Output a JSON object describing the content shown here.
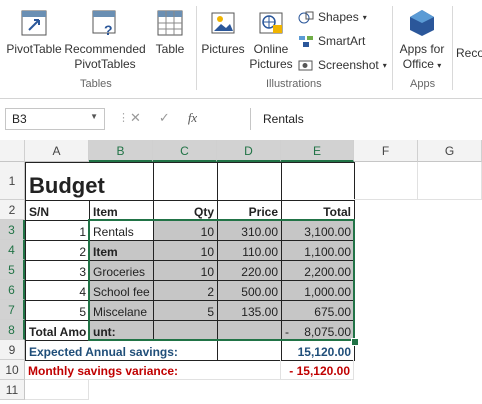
{
  "ribbon": {
    "pivottable": "PivotTable",
    "recommended_1": "Recommended",
    "recommended_2": "PivotTables",
    "table": "Table",
    "tables_group": "Tables",
    "pictures": "Pictures",
    "online_1": "Online",
    "online_2": "Pictures",
    "shapes": "Shapes",
    "smartart": "SmartArt",
    "screenshot": "Screenshot",
    "illustrations_group": "Illustrations",
    "apps_1": "Apps for",
    "apps_2": "Office",
    "apps_group": "Apps",
    "reco": "Reco"
  },
  "formula_bar": {
    "name_box": "B3",
    "cancel": "✕",
    "enter": "✓",
    "fx": "fx",
    "formula": "Rentals"
  },
  "columns": [
    "A",
    "B",
    "C",
    "D",
    "E",
    "F",
    "G"
  ],
  "rows": [
    "1",
    "2",
    "3",
    "4",
    "5",
    "6",
    "7",
    "8",
    "9",
    "10",
    "11"
  ],
  "sheet": {
    "title": "Budget",
    "headers": {
      "sn": "S/N",
      "item": "Item",
      "qty": "Qty",
      "price": "Price",
      "total": "Total"
    },
    "items": [
      {
        "sn": "1",
        "item": "Rentals",
        "qty": "10",
        "price": "310.00",
        "total": "3,100.00"
      },
      {
        "sn": "2",
        "item": "Item",
        "qty": "10",
        "price": "110.00",
        "total": "1,100.00"
      },
      {
        "sn": "3",
        "item": "Groceries",
        "qty": "10",
        "price": "220.00",
        "total": "2,200.00"
      },
      {
        "sn": "4",
        "item": "School fee",
        "qty": "2",
        "price": "500.00",
        "total": "1,000.00"
      },
      {
        "sn": "5",
        "item": "Miscelane",
        "qty": "5",
        "price": "135.00",
        "total": "675.00"
      }
    ],
    "total_label_a": "Total Amo",
    "total_label_b": "unt:",
    "total_dash": "-",
    "total_value": "8,075.00",
    "expected_label": "Expected Annual savings:",
    "expected_value": "15,120.00",
    "variance_label": "Monthly savings variance:",
    "variance_value": "- 15,120.00"
  },
  "colors": {
    "accent": "#217346",
    "blue_label": "#1f4e79",
    "red_label": "#c00000",
    "selection": "#c6c6c6"
  }
}
